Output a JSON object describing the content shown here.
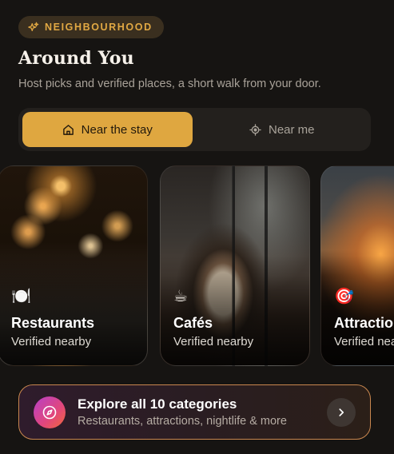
{
  "badge": {
    "label": "NEIGHBOURHOOD",
    "icon": "sparkles-icon"
  },
  "header": {
    "title": "Around You",
    "subtitle": "Host picks and verified places, a short walk from your door."
  },
  "toggle": {
    "options": [
      {
        "label": "Near the stay",
        "icon": "home-icon",
        "selected": true
      },
      {
        "label": "Near me",
        "icon": "locate-icon",
        "selected": false
      }
    ]
  },
  "categories": [
    {
      "name": "Restaurants",
      "subtitle": "Verified nearby",
      "emoji": "🍽️"
    },
    {
      "name": "Cafés",
      "subtitle": "Verified nearby",
      "emoji": "☕"
    },
    {
      "name": "Attractions",
      "subtitle": "Verified nearby",
      "emoji": "🎯"
    }
  ],
  "explore": {
    "title": "Explore all 10 categories",
    "subtitle": "Restaurants, attractions, nightlife & more",
    "icon": "compass-icon",
    "arrow_icon": "chevron-right-icon"
  },
  "colors": {
    "background": "#161412",
    "accent": "#dfa740",
    "badge_text": "#e1a843",
    "border_accent": "#c9874f"
  }
}
